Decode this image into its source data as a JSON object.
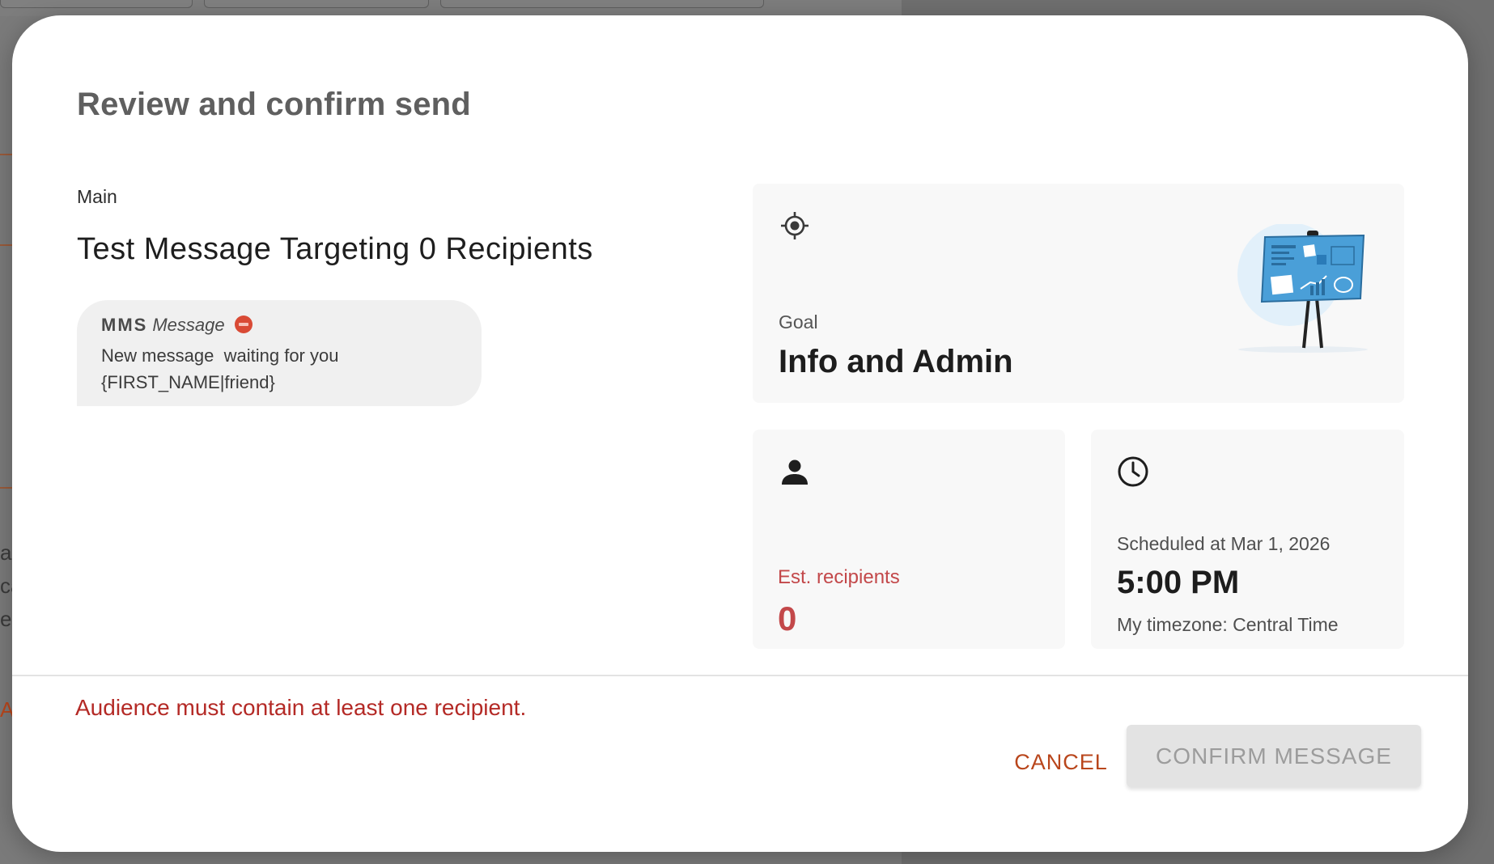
{
  "dialog": {
    "title": "Review and confirm send",
    "section_label": "Main",
    "message_heading": "Test Message Targeting 0 Recipients"
  },
  "message_preview": {
    "type": "MMS",
    "type_suffix": "Message",
    "status_icon": "stop-sign-icon",
    "body": "New message  waiting for you\n{FIRST_NAME|friend}"
  },
  "goal_card": {
    "icon": "target-icon",
    "label": "Goal",
    "value": "Info and Admin",
    "illustration": "presentation-board-illustration"
  },
  "recipients_card": {
    "icon": "person-icon",
    "label": "Est. recipients",
    "value": "0"
  },
  "schedule_card": {
    "icon": "clock-icon",
    "label": "Scheduled at Mar 1, 2026",
    "time": "5:00 PM",
    "timezone": "My timezone: Central Time"
  },
  "footer": {
    "error": "Audience must contain at least one recipient.",
    "cancel_label": "CANCEL",
    "confirm_label": "CONFIRM MESSAGE"
  },
  "background_fragments": {
    "left_letters": [
      "al",
      "ca",
      "er"
    ],
    "left_orange": "AS"
  },
  "colors": {
    "error": "#b42a26",
    "accent": "#b9461c",
    "recipients_alert": "#c3484a",
    "disabled_button": "#e3e3e3"
  }
}
